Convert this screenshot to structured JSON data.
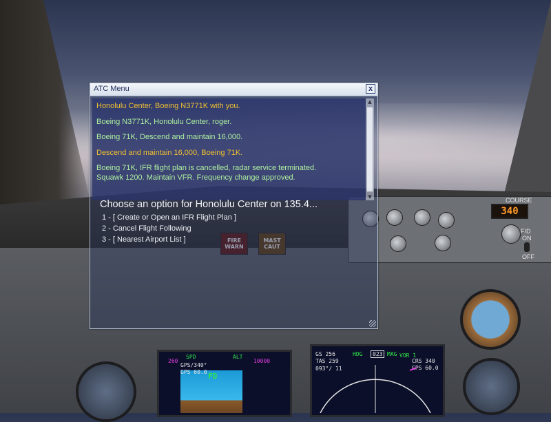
{
  "window": {
    "title": "ATC Menu",
    "close_label": "x"
  },
  "messages": [
    {
      "text": "Honolulu Center, Boeing N3771K with you.",
      "color": "#f0c030"
    },
    {
      "text": "Boeing N3771K, Honolulu Center, roger.",
      "color": "#aef0a0"
    },
    {
      "text": "Boeing 71K, Descend and maintain 16,000.",
      "color": "#aef0a0"
    },
    {
      "text": "Descend and maintain 16,000, Boeing 71K.",
      "color": "#f0c030"
    },
    {
      "text": "Boeing 71K, IFR flight plan is cancelled, radar service terminated. Squawk 1200. Maintain VFR. Frequency change approved.",
      "color": "#aef0a0"
    }
  ],
  "prompt": "Choose an option for Honolulu Center on 135.4...",
  "options": [
    "1 - [ Create or Open an IFR Flight Plan ]",
    "2 - Cancel Flight Following",
    "3 - [ Nearest Airport List ]"
  ],
  "cockpit": {
    "course_label": "COURSE",
    "course_value": "340",
    "fd_label": "F/D",
    "fd_state": "ON",
    "off_label": "OFF",
    "fire_warn": "FIRE\nWARN",
    "master_caut": "MAST\nCAUT",
    "pfd": {
      "spd_label": "SPD",
      "alt_label": "ALT",
      "fd_label": "FD",
      "gps_track": "GPS/340°",
      "gps_speed": "GPS 60.0",
      "speed_top": "260",
      "alt_top": "10000"
    },
    "nd": {
      "hdg_label": "HDG",
      "hdg_value": "023",
      "mag_label": "MAG",
      "vor_label": "VOR 1",
      "gs": "GS 256",
      "tas": "TAS 259",
      "wind": "093°/ 11",
      "crs": "CRS 340",
      "gps": "GPS 60.0"
    }
  },
  "colors": {
    "pilot_text": "#f0c030",
    "atc_text": "#aef0a0",
    "lcd_text": "#ff9a2a",
    "pfd_green": "#2ee84a",
    "pfd_magenta": "#e23ce0"
  }
}
